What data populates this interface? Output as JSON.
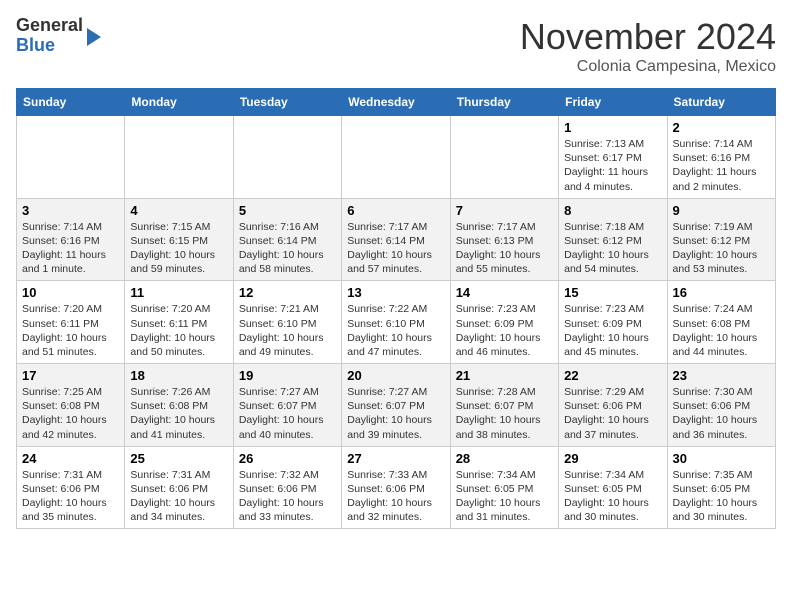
{
  "header": {
    "logo_line1": "General",
    "logo_line2": "Blue",
    "month": "November 2024",
    "location": "Colonia Campesina, Mexico"
  },
  "weekdays": [
    "Sunday",
    "Monday",
    "Tuesday",
    "Wednesday",
    "Thursday",
    "Friday",
    "Saturday"
  ],
  "weeks": [
    [
      {
        "day": "",
        "info": ""
      },
      {
        "day": "",
        "info": ""
      },
      {
        "day": "",
        "info": ""
      },
      {
        "day": "",
        "info": ""
      },
      {
        "day": "",
        "info": ""
      },
      {
        "day": "1",
        "info": "Sunrise: 7:13 AM\nSunset: 6:17 PM\nDaylight: 11 hours and 4 minutes."
      },
      {
        "day": "2",
        "info": "Sunrise: 7:14 AM\nSunset: 6:16 PM\nDaylight: 11 hours and 2 minutes."
      }
    ],
    [
      {
        "day": "3",
        "info": "Sunrise: 7:14 AM\nSunset: 6:16 PM\nDaylight: 11 hours and 1 minute."
      },
      {
        "day": "4",
        "info": "Sunrise: 7:15 AM\nSunset: 6:15 PM\nDaylight: 10 hours and 59 minutes."
      },
      {
        "day": "5",
        "info": "Sunrise: 7:16 AM\nSunset: 6:14 PM\nDaylight: 10 hours and 58 minutes."
      },
      {
        "day": "6",
        "info": "Sunrise: 7:17 AM\nSunset: 6:14 PM\nDaylight: 10 hours and 57 minutes."
      },
      {
        "day": "7",
        "info": "Sunrise: 7:17 AM\nSunset: 6:13 PM\nDaylight: 10 hours and 55 minutes."
      },
      {
        "day": "8",
        "info": "Sunrise: 7:18 AM\nSunset: 6:12 PM\nDaylight: 10 hours and 54 minutes."
      },
      {
        "day": "9",
        "info": "Sunrise: 7:19 AM\nSunset: 6:12 PM\nDaylight: 10 hours and 53 minutes."
      }
    ],
    [
      {
        "day": "10",
        "info": "Sunrise: 7:20 AM\nSunset: 6:11 PM\nDaylight: 10 hours and 51 minutes."
      },
      {
        "day": "11",
        "info": "Sunrise: 7:20 AM\nSunset: 6:11 PM\nDaylight: 10 hours and 50 minutes."
      },
      {
        "day": "12",
        "info": "Sunrise: 7:21 AM\nSunset: 6:10 PM\nDaylight: 10 hours and 49 minutes."
      },
      {
        "day": "13",
        "info": "Sunrise: 7:22 AM\nSunset: 6:10 PM\nDaylight: 10 hours and 47 minutes."
      },
      {
        "day": "14",
        "info": "Sunrise: 7:23 AM\nSunset: 6:09 PM\nDaylight: 10 hours and 46 minutes."
      },
      {
        "day": "15",
        "info": "Sunrise: 7:23 AM\nSunset: 6:09 PM\nDaylight: 10 hours and 45 minutes."
      },
      {
        "day": "16",
        "info": "Sunrise: 7:24 AM\nSunset: 6:08 PM\nDaylight: 10 hours and 44 minutes."
      }
    ],
    [
      {
        "day": "17",
        "info": "Sunrise: 7:25 AM\nSunset: 6:08 PM\nDaylight: 10 hours and 42 minutes."
      },
      {
        "day": "18",
        "info": "Sunrise: 7:26 AM\nSunset: 6:08 PM\nDaylight: 10 hours and 41 minutes."
      },
      {
        "day": "19",
        "info": "Sunrise: 7:27 AM\nSunset: 6:07 PM\nDaylight: 10 hours and 40 minutes."
      },
      {
        "day": "20",
        "info": "Sunrise: 7:27 AM\nSunset: 6:07 PM\nDaylight: 10 hours and 39 minutes."
      },
      {
        "day": "21",
        "info": "Sunrise: 7:28 AM\nSunset: 6:07 PM\nDaylight: 10 hours and 38 minutes."
      },
      {
        "day": "22",
        "info": "Sunrise: 7:29 AM\nSunset: 6:06 PM\nDaylight: 10 hours and 37 minutes."
      },
      {
        "day": "23",
        "info": "Sunrise: 7:30 AM\nSunset: 6:06 PM\nDaylight: 10 hours and 36 minutes."
      }
    ],
    [
      {
        "day": "24",
        "info": "Sunrise: 7:31 AM\nSunset: 6:06 PM\nDaylight: 10 hours and 35 minutes."
      },
      {
        "day": "25",
        "info": "Sunrise: 7:31 AM\nSunset: 6:06 PM\nDaylight: 10 hours and 34 minutes."
      },
      {
        "day": "26",
        "info": "Sunrise: 7:32 AM\nSunset: 6:06 PM\nDaylight: 10 hours and 33 minutes."
      },
      {
        "day": "27",
        "info": "Sunrise: 7:33 AM\nSunset: 6:06 PM\nDaylight: 10 hours and 32 minutes."
      },
      {
        "day": "28",
        "info": "Sunrise: 7:34 AM\nSunset: 6:05 PM\nDaylight: 10 hours and 31 minutes."
      },
      {
        "day": "29",
        "info": "Sunrise: 7:34 AM\nSunset: 6:05 PM\nDaylight: 10 hours and 30 minutes."
      },
      {
        "day": "30",
        "info": "Sunrise: 7:35 AM\nSunset: 6:05 PM\nDaylight: 10 hours and 30 minutes."
      }
    ]
  ]
}
